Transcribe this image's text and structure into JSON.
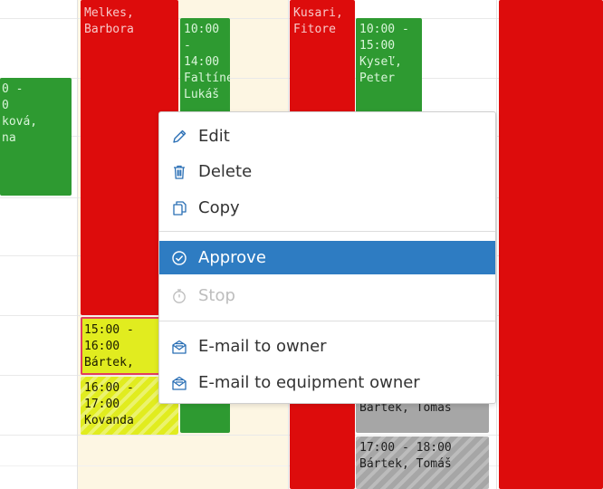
{
  "events": {
    "left_partial": [
      "0 -",
      "0",
      "ková,",
      "na"
    ],
    "melkes": [
      "Melkes,",
      "Barbora"
    ],
    "faltinek": [
      "10:00 -",
      "14:00",
      "Faltínek,",
      "Lukáš"
    ],
    "kusari": [
      "Kusari,",
      "Fitore"
    ],
    "kysel": [
      "10:00 -",
      "15:00",
      "Kyseľ,",
      "Peter"
    ],
    "bartek_yellow": [
      "15:00 -",
      "16:00",
      "Bártek,"
    ],
    "kovanda": [
      "16:00 -",
      "17:00",
      "Kovanda"
    ],
    "gray1": [
      "Bártek, Tomáš"
    ],
    "gray2": [
      "17:00 - 18:00",
      "Bártek, Tomáš"
    ]
  },
  "context_menu": {
    "items": [
      {
        "label": "Edit",
        "icon": "pencil-icon"
      },
      {
        "label": "Delete",
        "icon": "trash-icon"
      },
      {
        "label": "Copy",
        "icon": "copy-icon"
      },
      {
        "label": "Approve",
        "icon": "check-circle-icon",
        "state": "highlighted"
      },
      {
        "label": "Stop",
        "icon": "stopwatch-icon",
        "state": "disabled"
      },
      {
        "label": "E-mail to owner",
        "icon": "envelope-icon"
      },
      {
        "label": "E-mail to equipment owner",
        "icon": "envelope-icon"
      }
    ]
  },
  "colors": {
    "red": "#dd0c0c",
    "green": "#2e9a31",
    "yellow": "#e1ec1f",
    "gray": "#a6a6a6",
    "menu_highlight": "#2e7cc2",
    "icon_blue": "#2a6fb5"
  }
}
